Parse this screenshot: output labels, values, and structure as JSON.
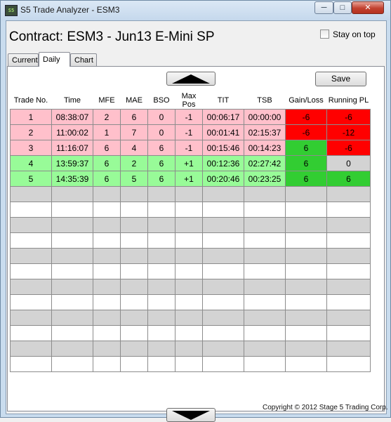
{
  "window": {
    "title": "S5 Trade Analyzer - ESM3",
    "icon_text": "S5",
    "minimize_glyph": "─",
    "maximize_glyph": "□",
    "close_glyph": "✕"
  },
  "header": {
    "contract_title": "Contract: ESM3 - Jun13 E-Mini SP",
    "stay_on_top_label": "Stay on top",
    "stay_on_top_checked": false
  },
  "tabs": [
    {
      "label": "Current",
      "active": false
    },
    {
      "label": "Daily",
      "active": true
    },
    {
      "label": "Chart",
      "active": false
    }
  ],
  "toolbar": {
    "save_label": "Save",
    "scroll_up_icon": "triangle-up-icon",
    "scroll_down_icon": "triangle-down-icon"
  },
  "table": {
    "columns": [
      {
        "label": "Trade No."
      },
      {
        "label": "Time"
      },
      {
        "label": "MFE"
      },
      {
        "label": "MAE"
      },
      {
        "label": "BSO"
      },
      {
        "label": "Max\nPos"
      },
      {
        "label": "TIT"
      },
      {
        "label": "TSB"
      },
      {
        "label": "Gain/Loss"
      },
      {
        "label": "Running PL"
      }
    ],
    "rows": [
      {
        "cells": [
          "1",
          "08:38:07",
          "2",
          "6",
          "0",
          "-1",
          "00:06:17",
          "00:00:00",
          "-6",
          "-6"
        ],
        "tone": "pink",
        "gain_color": "red",
        "running_color": "red"
      },
      {
        "cells": [
          "2",
          "11:00:02",
          "1",
          "7",
          "0",
          "-1",
          "00:01:41",
          "02:15:37",
          "-6",
          "-12"
        ],
        "tone": "pink",
        "gain_color": "red",
        "running_color": "red"
      },
      {
        "cells": [
          "3",
          "11:16:07",
          "6",
          "4",
          "6",
          "-1",
          "00:15:46",
          "00:14:23",
          "6",
          "-6"
        ],
        "tone": "pink",
        "gain_color": "green",
        "running_color": "red"
      },
      {
        "cells": [
          "4",
          "13:59:37",
          "6",
          "2",
          "6",
          "+1",
          "00:12:36",
          "02:27:42",
          "6",
          "0"
        ],
        "tone": "green",
        "gain_color": "green",
        "running_color": "gray"
      },
      {
        "cells": [
          "5",
          "14:35:39",
          "6",
          "5",
          "6",
          "+1",
          "00:20:46",
          "00:23:25",
          "6",
          "6"
        ],
        "tone": "green",
        "gain_color": "green",
        "running_color": "green"
      }
    ],
    "empty_rows": 12
  },
  "colors": {
    "loss_row": "#ffc0cb",
    "win_row": "#98fb98",
    "loss_cell": "#ff0000",
    "win_cell": "#32cd32",
    "flat_cell": "#d3d3d3"
  },
  "footer": {
    "copyright": "Copyright © 2012 Stage 5 Trading Corp."
  }
}
